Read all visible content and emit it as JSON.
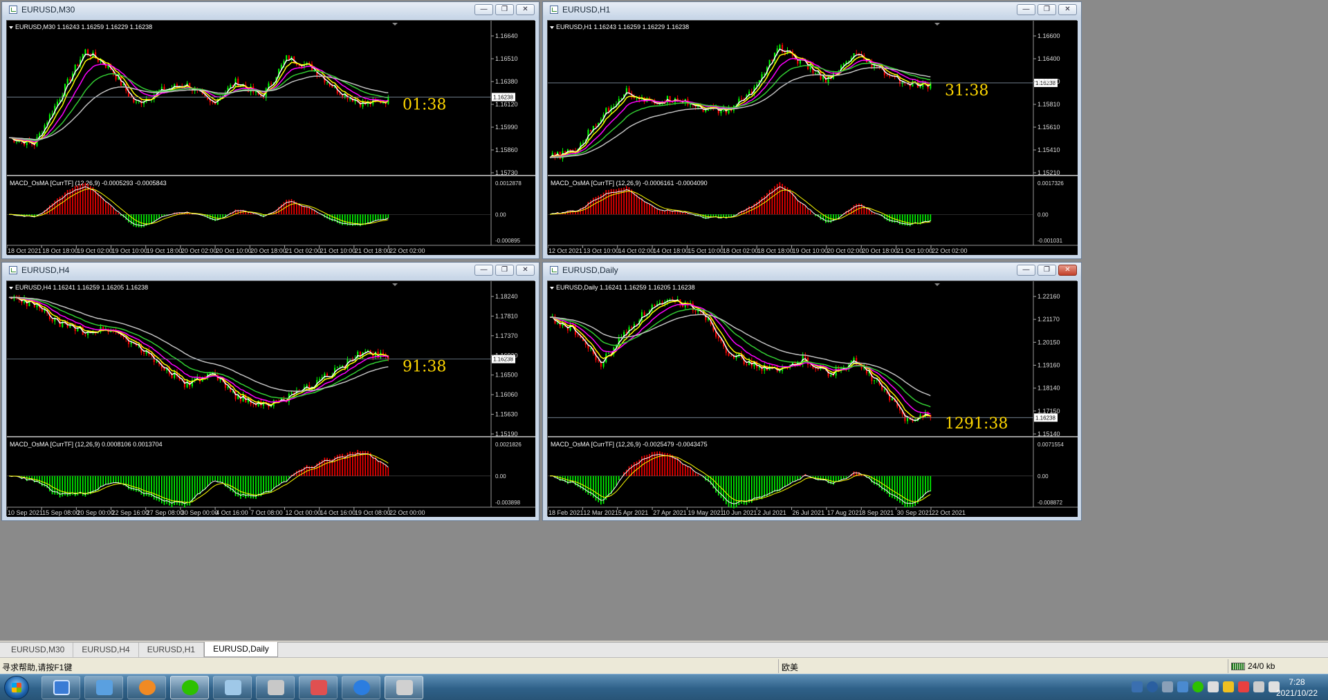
{
  "windows": [
    {
      "id": "m30",
      "title": "EURUSD,M30",
      "active": false,
      "header": "EURUSD,M30  1.16243 1.16259 1.16229 1.16238",
      "price_ticks": [
        "1.16640",
        "1.16510",
        "1.16380",
        "1.16120",
        "1.15990",
        "1.15860",
        "1.15730"
      ],
      "current_price": "1.16238",
      "timer": "01:38",
      "macd_header": "MACD_OsMA [CurrTF] (12,26,9) -0.0005293 -0.0005843",
      "macd_ticks": [
        "0.0012878",
        "0.00",
        "-0.000895"
      ],
      "time_labels": [
        "18 Oct 2021",
        "18 Oct 18:00",
        "19 Oct 02:00",
        "19 Oct 10:00",
        "19 Oct 18:00",
        "20 Oct 02:00",
        "20 Oct 10:00",
        "20 Oct 18:00",
        "21 Oct 02:00",
        "21 Oct 10:00",
        "21 Oct 18:00",
        "22 Oct 02:00"
      ]
    },
    {
      "id": "h1",
      "title": "EURUSD,H1",
      "active": false,
      "header": "EURUSD,H1  1.16243 1.16259 1.16229 1.16238",
      "price_ticks": [
        "1.16600",
        "1.16400",
        "1.16000",
        "1.15810",
        "1.15610",
        "1.15410",
        "1.15210"
      ],
      "current_price": "1.16238",
      "timer": "31:38",
      "macd_header": "MACD_OsMA [CurrTF] (12,26,9) -0.0006161 -0.0004090",
      "macd_ticks": [
        "0.0017326",
        "0.00",
        "-0.001031"
      ],
      "time_labels": [
        "12 Oct 2021",
        "13 Oct 10:00",
        "14 Oct 02:00",
        "14 Oct 18:00",
        "15 Oct 10:00",
        "18 Oct 02:00",
        "18 Oct 18:00",
        "19 Oct 10:00",
        "20 Oct 02:00",
        "20 Oct 18:00",
        "21 Oct 10:00",
        "22 Oct 02:00"
      ]
    },
    {
      "id": "h4",
      "title": "EURUSD,H4",
      "active": false,
      "header": "EURUSD,H4  1.16241 1.16259 1.16205 1.16238",
      "price_ticks": [
        "1.18240",
        "1.17810",
        "1.17370",
        "1.16930",
        "1.16500",
        "1.16060",
        "1.15630",
        "1.15190"
      ],
      "current_price": "1.16238",
      "timer": "91:38",
      "macd_header": "MACD_OsMA [CurrTF] (12,26,9) 0.0008106 0.0013704",
      "macd_ticks": [
        "0.0021826",
        "0.00",
        "-0.003898"
      ],
      "time_labels": [
        "10 Sep 2021",
        "15 Sep 08:00",
        "20 Sep 00:00",
        "22 Sep 16:00",
        "27 Sep 08:00",
        "30 Sep 00:00",
        "4 Oct 16:00",
        "7 Oct 08:00",
        "12 Oct 00:00",
        "14 Oct 16:00",
        "19 Oct 08:00",
        "22 Oct 00:00"
      ]
    },
    {
      "id": "d1",
      "title": "EURUSD,Daily",
      "active": true,
      "header": "EURUSD,Daily  1.16241 1.16259 1.16205 1.16238",
      "price_ticks": [
        "1.22160",
        "1.21170",
        "1.20150",
        "1.19160",
        "1.18140",
        "1.17150",
        "1.15140"
      ],
      "current_price": "1.16238",
      "timer": "1291:38",
      "macd_header": "MACD_OsMA [CurrTF] (12,26,9) -0.0025479 -0.0043475",
      "macd_ticks": [
        "0.0071554",
        "0.00",
        "-0.008872"
      ],
      "time_labels": [
        "18 Feb 2021",
        "12 Mar 2021",
        "5 Apr 2021",
        "27 Apr 2021",
        "19 May 2021",
        "10 Jun 2021",
        "2 Jul 2021",
        "26 Jul 2021",
        "17 Aug 2021",
        "8 Sep 2021",
        "30 Sep 2021",
        "22 Oct 2021"
      ]
    }
  ],
  "window_controls": {
    "minimize": "—",
    "restore": "❐",
    "close": "✕"
  },
  "tabs": [
    "EURUSD,M30",
    "EURUSD,H4",
    "EURUSD,H1",
    "EURUSD,Daily"
  ],
  "active_tab": 3,
  "status": {
    "help": "寻求帮助,请按F1键",
    "profile": "欧美",
    "connection": "24/0 kb"
  },
  "clock": {
    "time": "7:28",
    "date": "2021/10/22"
  },
  "colors": {
    "bull": "#00ff00",
    "bear": "#ff0000",
    "ma_fast": "#ffffff",
    "ma_yellow": "#ffff00",
    "ma_magenta": "#ff00ff",
    "ma_green": "#32cd32",
    "ma_gray": "#c0c0c0",
    "timer": "#ffd700"
  }
}
